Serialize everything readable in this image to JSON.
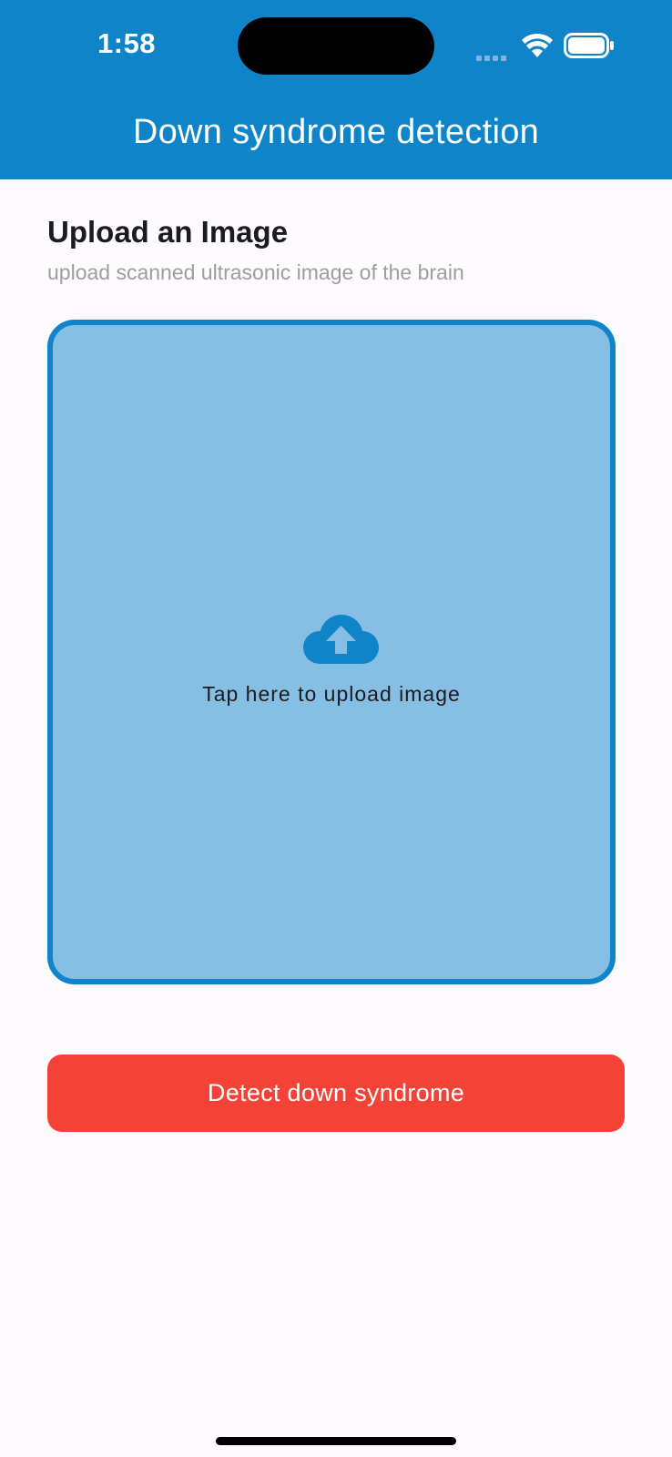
{
  "status_bar": {
    "time": "1:58"
  },
  "app_bar": {
    "title": "Down syndrome detection"
  },
  "upload_section": {
    "title": "Upload an Image",
    "subtitle": "upload scanned ultrasonic image of the brain",
    "box_label": "Tap here to upload image",
    "icon": "cloud-upload-icon"
  },
  "actions": {
    "detect_label": "Detect down syndrome"
  },
  "colors": {
    "primary": "#0f84c9",
    "upload_fill": "#86bee4",
    "button": "#f44336",
    "background": "#fefbfe"
  }
}
